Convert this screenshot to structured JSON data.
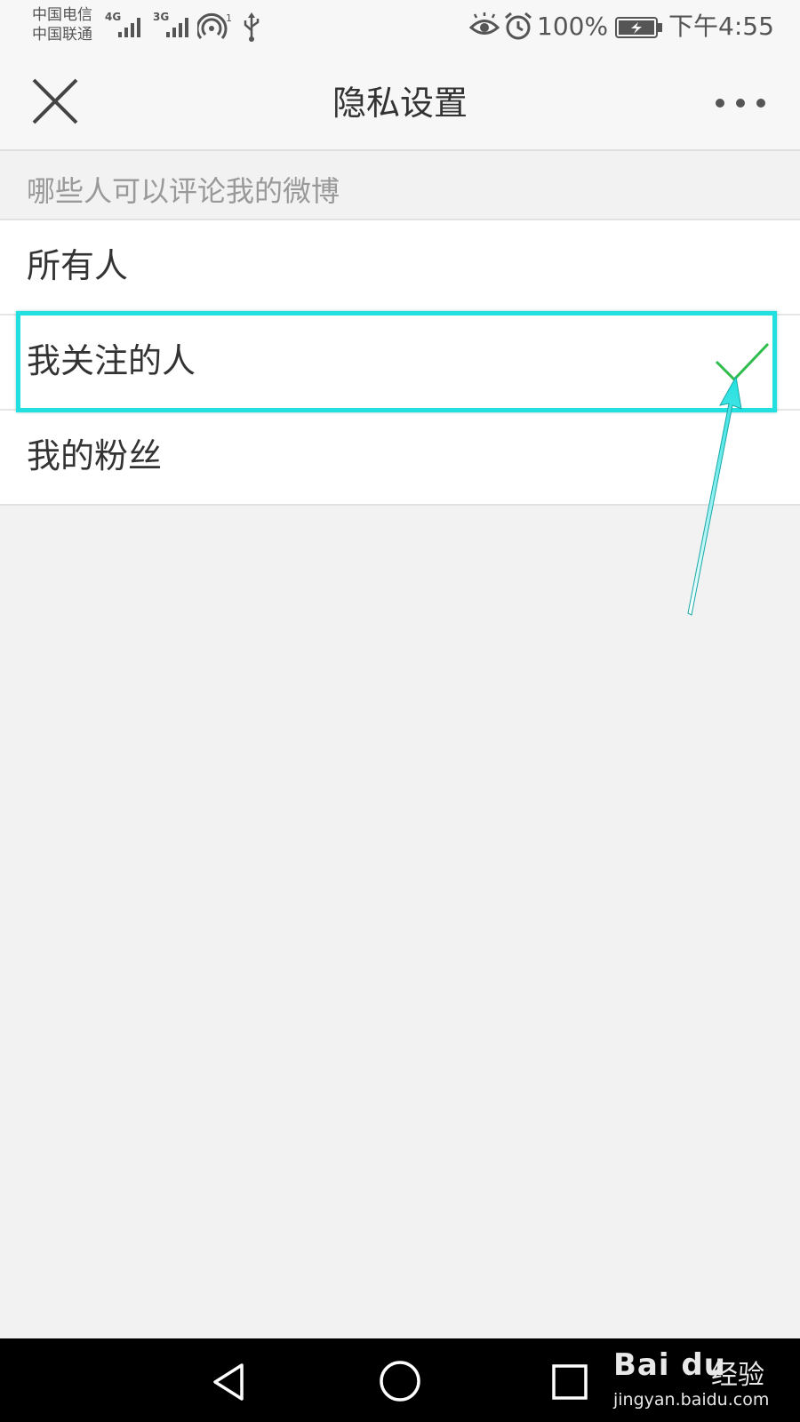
{
  "status_bar": {
    "carrier_1": "中国电信",
    "carrier_2": "中国联通",
    "network_1": "4G",
    "network_2": "3G",
    "hotspot_count": "1",
    "battery": "100%",
    "time": "下午4:55"
  },
  "header": {
    "title": "隐私设置"
  },
  "section": {
    "title": "哪些人可以评论我的微博"
  },
  "options": [
    {
      "label": "所有人",
      "selected": false
    },
    {
      "label": "我关注的人",
      "selected": true
    },
    {
      "label": "我的粉丝",
      "selected": false
    }
  ],
  "colors": {
    "check": "#2ebd4c",
    "highlight": "#22e0e0",
    "background": "#f2f2f2"
  },
  "watermark": {
    "brand": "Bai du",
    "cn": "经验",
    "url": "jingyan.baidu.com"
  }
}
